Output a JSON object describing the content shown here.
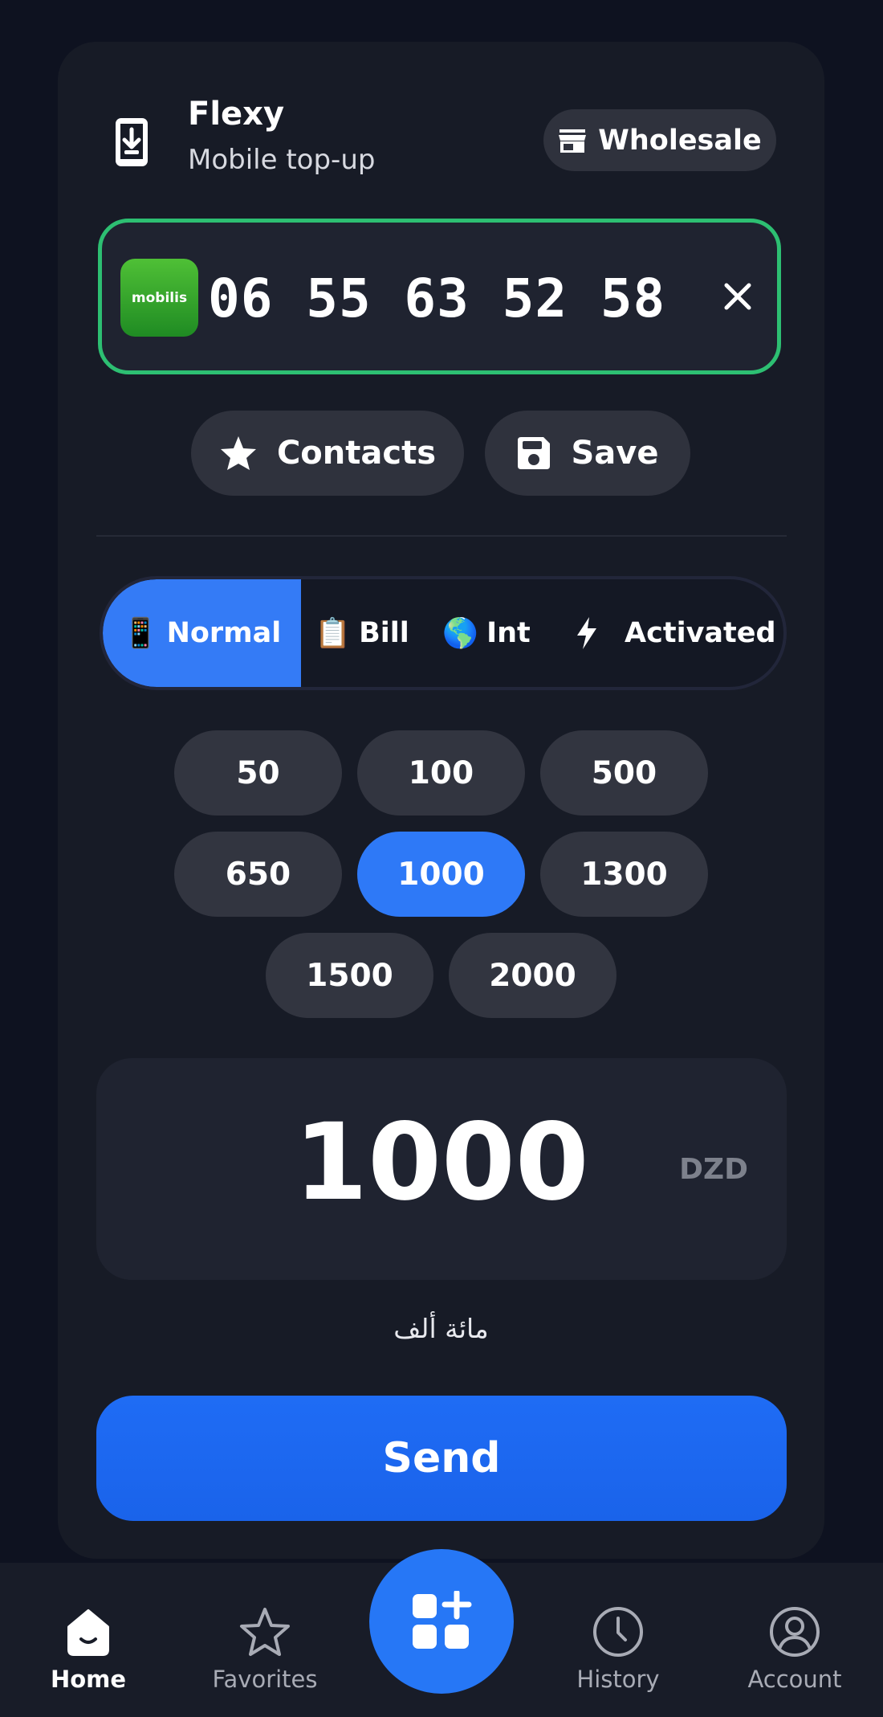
{
  "header": {
    "title": "Flexy",
    "subtitle": "Mobile top-up",
    "wholesale_label": "Wholesale",
    "icon": "download-phone-icon"
  },
  "phone": {
    "operator": "mobilis",
    "number": "06 55 63 52 58",
    "accent_color": "#2dbf72"
  },
  "actions": {
    "contacts_label": "Contacts",
    "save_label": "Save"
  },
  "tabs": [
    {
      "emoji": "📱",
      "label": "Normal",
      "active": true
    },
    {
      "emoji": "📋",
      "label": "Bill",
      "active": false
    },
    {
      "emoji": "🌎",
      "label": "Int",
      "active": false
    },
    {
      "icon": "lightning-icon",
      "label": "Activated",
      "active": false
    }
  ],
  "amounts": [
    "50",
    "100",
    "500",
    "650",
    "1000",
    "1300",
    "1500",
    "2000"
  ],
  "selected_amount": "1000",
  "amount_panel": {
    "value": "1000",
    "currency": "DZD",
    "words": "مائة ألف"
  },
  "send_label": "Send",
  "nav": {
    "home": "Home",
    "favorites": "Favorites",
    "history": "History",
    "account": "Account"
  },
  "colors": {
    "primary": "#2677f6",
    "background": "#0e1220",
    "card": "#171b26"
  }
}
